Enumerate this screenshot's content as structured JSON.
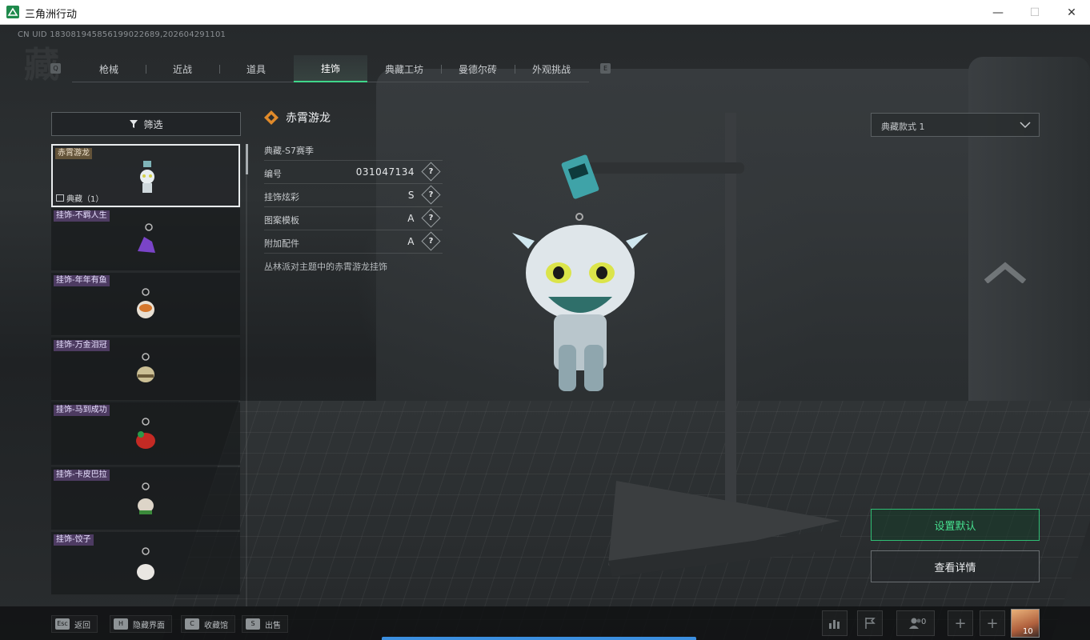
{
  "window": {
    "title": "三角洲行动",
    "controls": {
      "minimize": "—",
      "maximize": "☐",
      "close": "✕"
    }
  },
  "uid_text": "CN UID 18308194585619902268​9,202604291101",
  "tabs": {
    "left_key": "Q",
    "right_key": "E",
    "items": [
      {
        "label": "枪械"
      },
      {
        "label": "近战"
      },
      {
        "label": "道具"
      },
      {
        "label": "挂饰",
        "active": true
      },
      {
        "label": "典藏工坊"
      },
      {
        "label": "曼德尔砖"
      },
      {
        "label": "外观挑战"
      }
    ]
  },
  "filter": {
    "label": "筛选",
    "icon": "funnel-icon"
  },
  "list": {
    "items": [
      {
        "tag": "赤霄游龙",
        "sub": "典藏（1）",
        "selected": true
      },
      {
        "tag": "挂饰-不羁人生"
      },
      {
        "tag": "挂饰-年年有鱼"
      },
      {
        "tag": "挂饰-万金泪冠"
      },
      {
        "tag": "挂饰-马到成功"
      },
      {
        "tag": "挂饰-卡皮巴拉"
      },
      {
        "tag": "挂饰-饺子"
      }
    ]
  },
  "detail": {
    "title": "赤霄游龙",
    "season": "典藏-S7赛季",
    "rows": [
      {
        "label": "编号",
        "value": "031047134"
      },
      {
        "label": "挂饰炫彩",
        "value": "S"
      },
      {
        "label": "图案模板",
        "value": "A"
      },
      {
        "label": "附加配件",
        "value": "A"
      }
    ],
    "description": "丛林派对主题中的赤霄游龙挂饰",
    "help_glyph": "?"
  },
  "style_select": {
    "value": "典藏款式 1"
  },
  "buttons": {
    "set_default": "设置默认",
    "view_detail": "查看详情"
  },
  "bottom_hints": [
    {
      "key": "Esc",
      "label": "返回"
    },
    {
      "key": "H",
      "label": "隐藏界面"
    },
    {
      "key": "C",
      "label": "收藏馆"
    },
    {
      "key": "S",
      "label": "出售"
    }
  ],
  "status_bar": {
    "friends_count": "0",
    "avatar_level": "10",
    "plus": "+"
  },
  "colors": {
    "accent_green": "#3fd78a",
    "progress_blue": "#3c8fe0"
  }
}
